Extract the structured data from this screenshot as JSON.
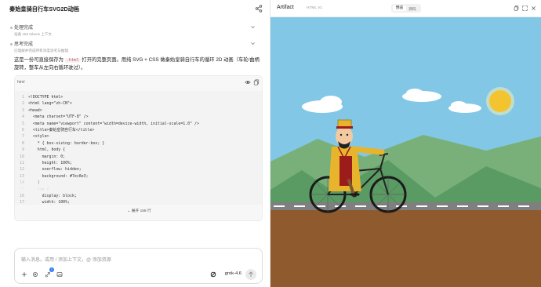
{
  "header": {
    "title": "秦始皇骑自行车SVG2D动画"
  },
  "steps": [
    {
      "title": "处理完成",
      "subtitle": "准备 453 tokens 上下文"
    },
    {
      "title": "思考完成",
      "subtitle": "已理解并完成所有深度思考与推理"
    }
  ],
  "intro": {
    "before": "这是一份可直接保存为 ",
    "code": ".html",
    "after": " 打开的完整页面。用纯 SVG + CSS 做秦始皇骑自行车的循环 2D 动画（车轮/曲柄旋转，整车从左向右循环驶过）。"
  },
  "codeblock": {
    "lang": "html",
    "lines": [
      {
        "n": "1",
        "t": "<!DOCTYPE html>"
      },
      {
        "n": "2",
        "t": "<html lang=\"zh-CN\">"
      },
      {
        "n": "3",
        "t": "<head>"
      },
      {
        "n": "4",
        "t": "  <meta charset=\"UTF-8\" />"
      },
      {
        "n": "5",
        "t": "  <meta name=\"viewport\" content=\"width=device-width, initial-scale=1.0\" />"
      },
      {
        "n": "6",
        "t": "  <title>秦始皇骑自行车</title>"
      },
      {
        "n": "7",
        "t": "  <style>"
      },
      {
        "n": "8",
        "t": "    * { box-sizing: border-box; }"
      },
      {
        "n": "9",
        "t": "    html, body {"
      },
      {
        "n": "10",
        "t": "      margin: 0;"
      },
      {
        "n": "11",
        "t": "      height: 100%;"
      },
      {
        "n": "12",
        "t": "      overflow: hidden;"
      },
      {
        "n": "13",
        "t": "      background: #7ec8e3;"
      },
      {
        "n": "14",
        "t": "    }"
      },
      {
        "n": "15",
        "t": "    svg {"
      },
      {
        "n": "16",
        "t": "      display: block;"
      },
      {
        "n": "17",
        "t": "      width: 100%;"
      }
    ],
    "expand_label": "展开 158 行"
  },
  "composer": {
    "placeholder": "输入消息。或用 / 添加上下文，@ 添加资源",
    "badge_count": "1",
    "model": "grok-4.6"
  },
  "artifact": {
    "title": "Artifact",
    "version": "HTML V1",
    "tab_preview": "预览",
    "tab_source": "源码"
  },
  "icons": [
    "chevron-down-icon",
    "share-icon",
    "eye-icon",
    "copy-icon",
    "plus-icon",
    "gear-icon",
    "link-icon",
    "image-icon",
    "grok-icon",
    "send-icon",
    "copy-icon",
    "fullscreen-icon",
    "close-icon"
  ],
  "colors": {
    "sky": "#82c8e6",
    "hill_dark": "#5a9a63",
    "hill_light": "#79b07a",
    "road": "#808080",
    "ground": "#8f5a2e",
    "sun": "#f4c430",
    "robe": "#e8b42c",
    "robe_red": "#9c1c1c"
  }
}
